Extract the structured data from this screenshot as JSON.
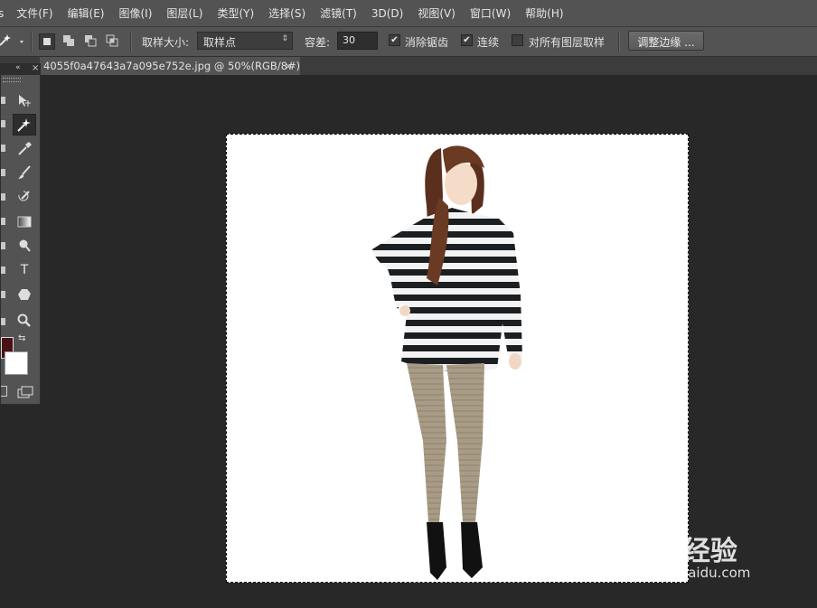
{
  "menubar": {
    "items": [
      "s",
      "文件(F)",
      "编辑(E)",
      "图像(I)",
      "图层(L)",
      "类型(Y)",
      "选择(S)",
      "滤镜(T)",
      "3D(D)",
      "视图(V)",
      "窗口(W)",
      "帮助(H)"
    ]
  },
  "options": {
    "sample_size_label": "取样大小:",
    "sample_size_value": "取样点",
    "tolerance_label": "容差:",
    "tolerance_value": "30",
    "antialias_label": "消除锯齿",
    "contiguous_label": "连续",
    "all_layers_label": "对所有图层取样",
    "refine_edge_label": "调整边缘 ...",
    "antialias_checked": "✔",
    "contiguous_checked": "✔"
  },
  "document": {
    "tab_title": "4055f0a47643a7a095e752e.jpg @ 50%(RGB/8#)",
    "close_glyph": "×"
  },
  "toolbox": {
    "text_tool_glyph": "T",
    "collapse_glyph": "«",
    "close_glyph": "×",
    "foreground_color": "#4a1214",
    "background_color": "#ffffff"
  },
  "watermark": {
    "brand": "Bai 经验",
    "url": "jingyan.baidu.com"
  }
}
